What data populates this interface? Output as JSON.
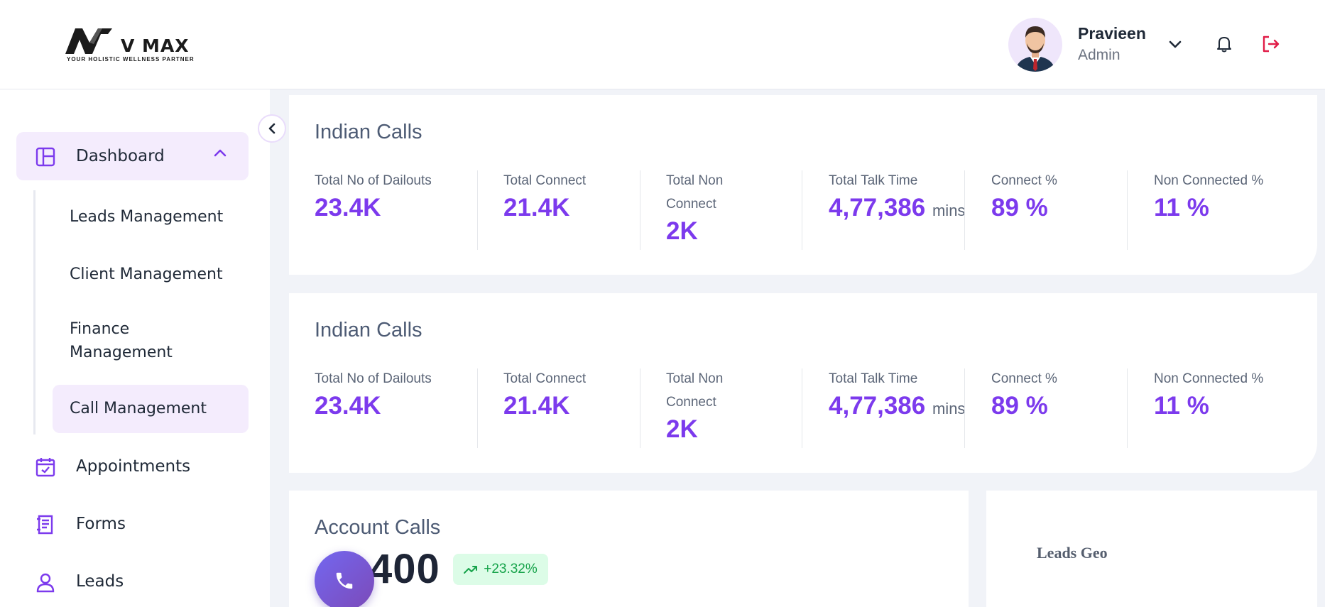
{
  "header": {
    "logo_brand": "V MAX",
    "logo_tagline": "YOUR HOLISTIC WELLNESS PARTNER",
    "user_name": "Pravieen",
    "user_role": "Admin"
  },
  "sidebar": {
    "items": [
      {
        "label": "Dashboard",
        "icon": "dashboard-icon",
        "active": true,
        "expanded": true
      },
      {
        "label": "Appointments",
        "icon": "calendar-check-icon"
      },
      {
        "label": "Forms",
        "icon": "form-icon"
      },
      {
        "label": "Leads",
        "icon": "user-icon"
      }
    ],
    "sub_items": [
      {
        "label": "Leads Management"
      },
      {
        "label": "Client Management"
      },
      {
        "label": "Finance Management"
      },
      {
        "label": "Call Management",
        "active": true
      }
    ]
  },
  "cards": [
    {
      "title": "Indian Calls",
      "stats": [
        {
          "label": "Total No of Dailouts",
          "value": "23.4K"
        },
        {
          "label": "Total Connect",
          "value": "21.4K"
        },
        {
          "label": "Total Non Connect",
          "value": "2K"
        },
        {
          "label": "Total Talk Time",
          "value": "4,77,386",
          "unit": "mins"
        },
        {
          "label": "Connect %",
          "value": "89 %"
        },
        {
          "label": "Non Connected %",
          "value": "11 %"
        }
      ]
    },
    {
      "title": "Indian Calls",
      "stats": [
        {
          "label": "Total No of Dailouts",
          "value": "23.4K"
        },
        {
          "label": "Total Connect",
          "value": "21.4K"
        },
        {
          "label": "Total Non Connect",
          "value": "2K"
        },
        {
          "label": "Total Talk Time",
          "value": "4,77,386",
          "unit": "mins"
        },
        {
          "label": "Connect %",
          "value": "89 %"
        },
        {
          "label": "Non Connected %",
          "value": "11 %"
        }
      ]
    }
  ],
  "account_calls": {
    "title": "Account Calls",
    "value": "400",
    "change": "+23.32%"
  },
  "leads_geo": {
    "title": "Leads Geo"
  },
  "colors": {
    "accent": "#7c3aed",
    "active_bg": "#f4ecfd",
    "logout": "#e11d48",
    "positive": "#16a34a"
  }
}
